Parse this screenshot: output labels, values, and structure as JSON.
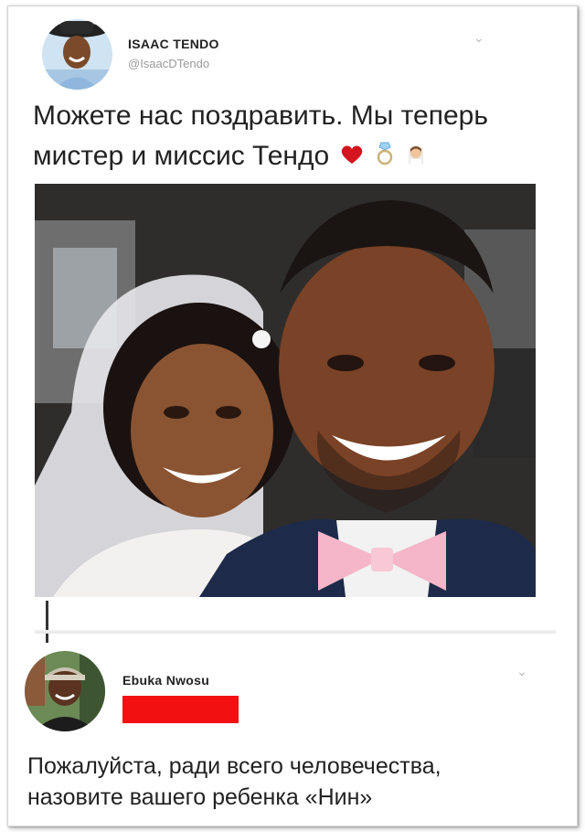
{
  "tweet": {
    "author_name": "ISAAC TENDO",
    "author_handle": "@IsaacDTendo",
    "text_line1": "Можете нас поздравить. Мы теперь",
    "text_line2": "мистер и миссис Тендо",
    "emojis": [
      "heart-emoji",
      "ring-emoji",
      "bride-emoji"
    ],
    "photo_alt": "Смеющиеся жених и невеста"
  },
  "reply": {
    "author_name": "Ebuka Nwosu",
    "handle_redacted": true,
    "text_line1": "Пожалуйста, ради всего человечества,",
    "text_line2": "назовите вашего ребенка «Нин»"
  },
  "colors": {
    "text": "#222222",
    "muted": "#9a9a9a",
    "redaction": "#f21010",
    "bow_tie": "#f4b6c8",
    "suit": "#1d2a4a"
  }
}
